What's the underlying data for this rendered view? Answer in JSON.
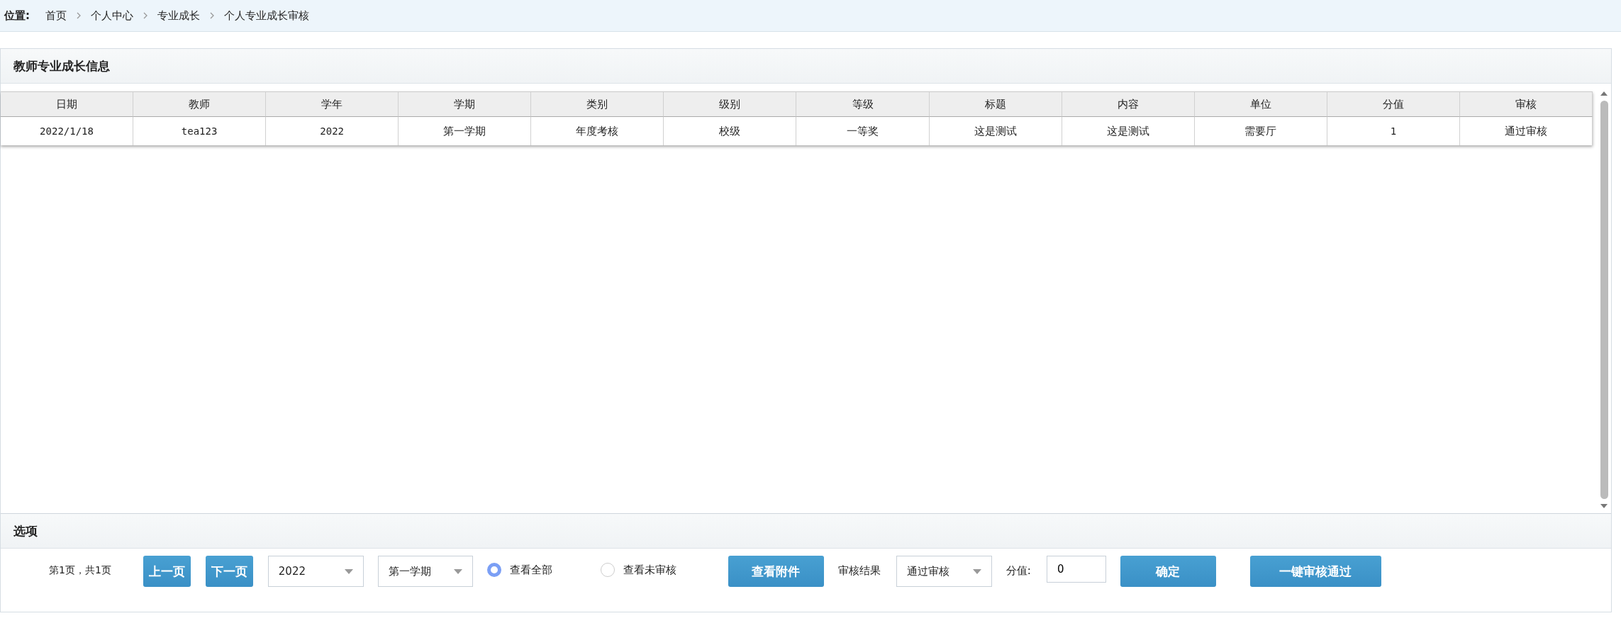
{
  "breadcrumb": {
    "label": "位置:",
    "items": [
      "首页",
      "个人中心",
      "专业成长",
      "个人专业成长审核"
    ]
  },
  "panel": {
    "title": "教师专业成长信息"
  },
  "table": {
    "columns": [
      "日期",
      "教师",
      "学年",
      "学期",
      "类别",
      "级别",
      "等级",
      "标题",
      "内容",
      "单位",
      "分值",
      "审核"
    ],
    "rows": [
      {
        "cells": [
          {
            "text": "2022/1/18",
            "kind": "mono"
          },
          {
            "text": "tea123",
            "kind": "mono"
          },
          {
            "text": "2022",
            "kind": "mono"
          },
          {
            "text": "第一学期",
            "kind": "text"
          },
          {
            "text": "年度考核",
            "kind": "text"
          },
          {
            "text": "校级",
            "kind": "text"
          },
          {
            "text": "一等奖",
            "kind": "text"
          },
          {
            "text": "这是测试",
            "kind": "text"
          },
          {
            "text": "这是测试",
            "kind": "text"
          },
          {
            "text": "需要厅",
            "kind": "text"
          },
          {
            "text": "1",
            "kind": "mono"
          },
          {
            "text": "通过审核",
            "kind": "text"
          }
        ]
      }
    ]
  },
  "options": {
    "title": "选项",
    "page_info": "第1页，共1页",
    "prev_button": "上一页",
    "next_button": "下一页",
    "year_select": {
      "value": "2022"
    },
    "term_select": {
      "value": "第一学期"
    },
    "radios": [
      {
        "label": "查看全部",
        "selected": true
      },
      {
        "label": "查看未审核",
        "selected": false
      }
    ],
    "attachment_button": "查看附件",
    "result_label": "审核结果",
    "result_select": {
      "value": "通过审核"
    },
    "score_label": "分值:",
    "score_input": {
      "value": "0"
    },
    "confirm_button": "确定",
    "approve_all_button": "一键审核通过"
  }
}
